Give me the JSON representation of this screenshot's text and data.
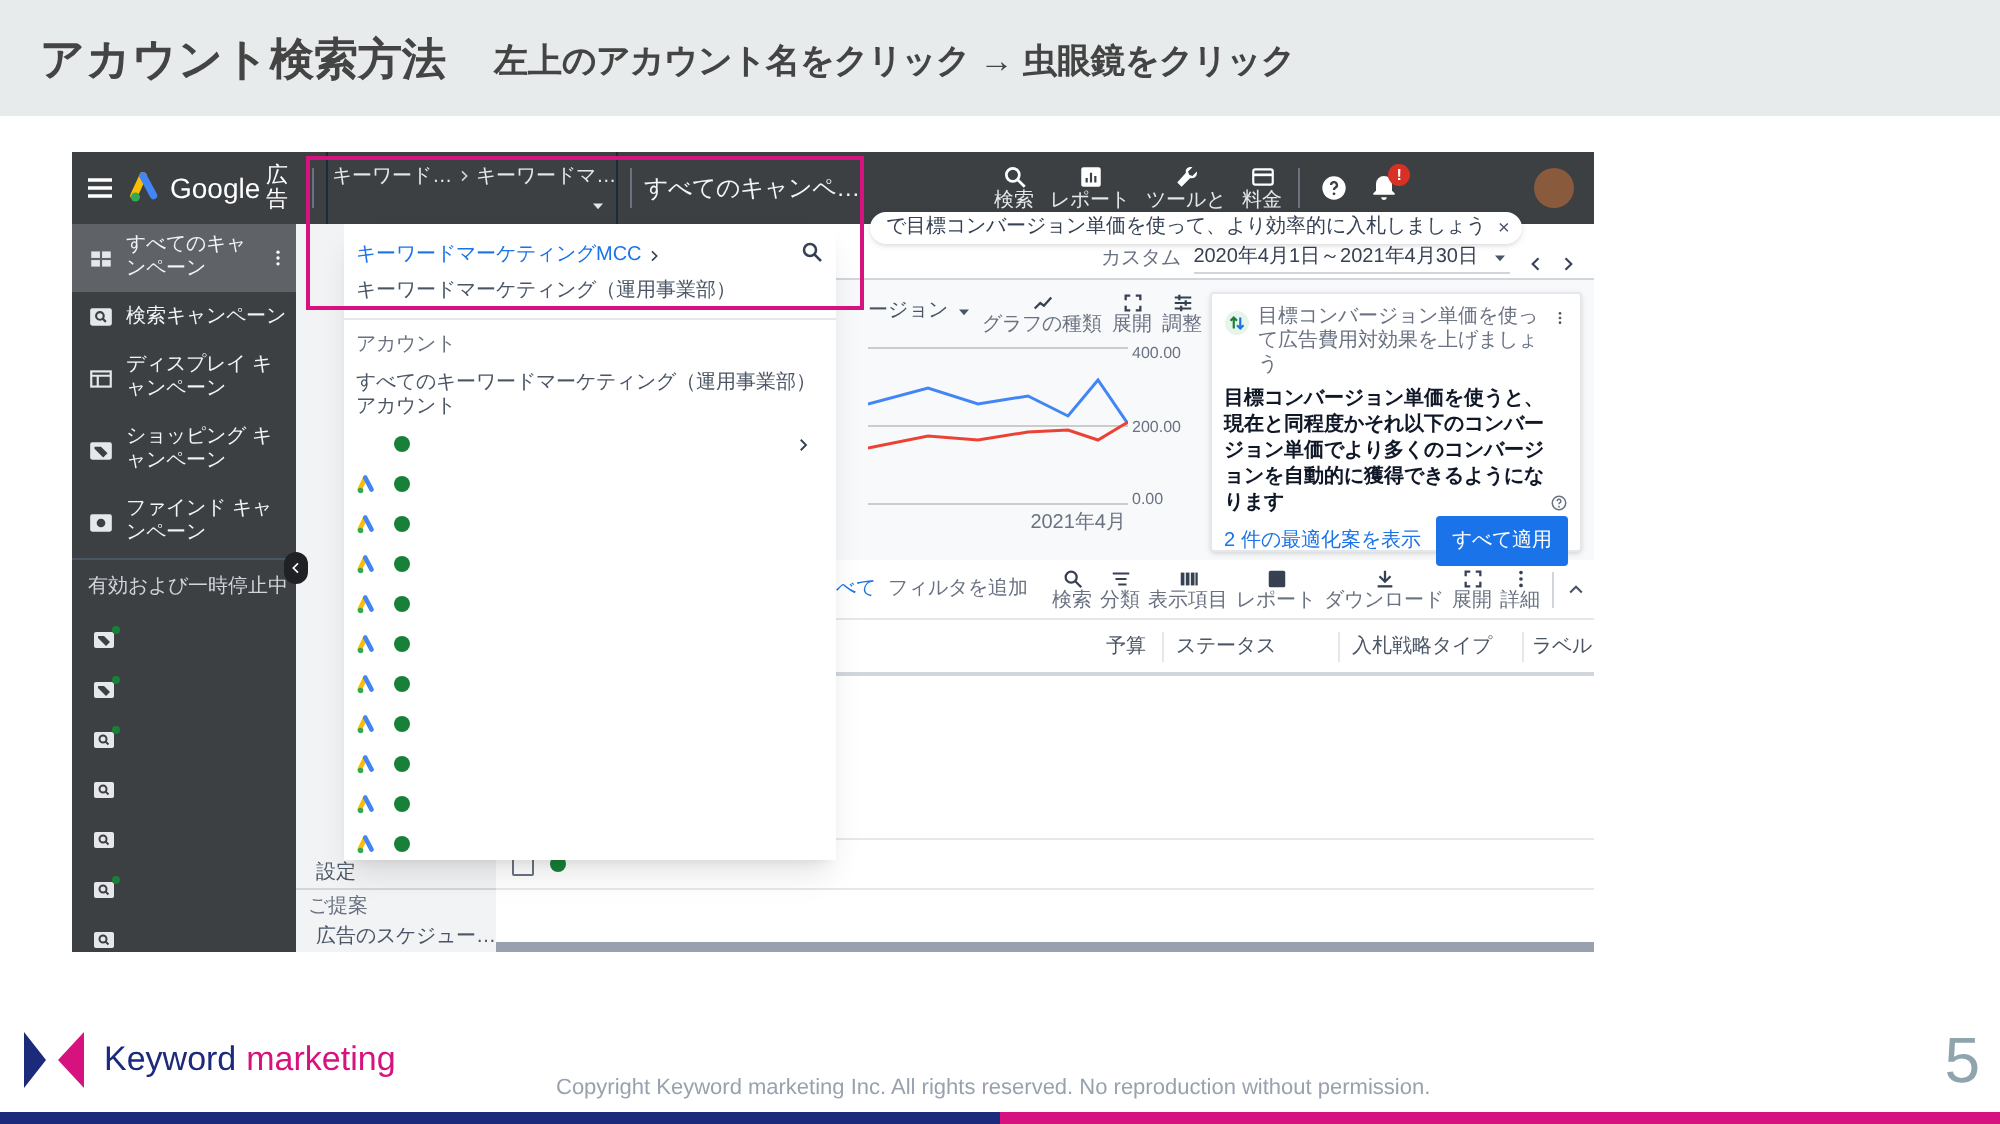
{
  "slide": {
    "title": "アカウント検索方法",
    "subtitle": "左上のアカウント名をクリック → 虫眼鏡をクリック",
    "brand_word1": "Keyword",
    "brand_word2": "marketing",
    "copyright": "Copyright Keyword marketing Inc. All rights reserved. No reproduction without permission.",
    "page_number": "5"
  },
  "app": {
    "header": {
      "product": "Google",
      "product_suffix": "広告",
      "account_path": [
        "キーワード…",
        "キーワードマ…"
      ],
      "scope": "すべてのキャンペ…",
      "tools": [
        {
          "kind": "search",
          "label": "検索"
        },
        {
          "kind": "report",
          "label": "レポート"
        },
        {
          "kind": "wrench",
          "label": "ツールと"
        },
        {
          "kind": "card",
          "label": "料金"
        }
      ],
      "notification_badge": "!"
    },
    "notice": {
      "text": "で目標コンバージョン単価を使って、より効率的に入札しましょう",
      "close": "×"
    },
    "sidebar": {
      "items": [
        {
          "kind": "grid",
          "label": "すべてのキャンペーン",
          "selected": true
        },
        {
          "kind": "search",
          "label": "検索キャンペーン",
          "selected": false
        },
        {
          "kind": "display",
          "label": "ディスプレイ キャンペーン",
          "selected": false
        },
        {
          "kind": "tag",
          "label": "ショッピング キャンペーン",
          "selected": false
        },
        {
          "kind": "find",
          "label": "ファインド キャンペーン",
          "selected": false
        }
      ],
      "filter_label": "有効および一時停止中",
      "campaigns": [
        {
          "kind": "tag",
          "active": true
        },
        {
          "kind": "tag",
          "active": true
        },
        {
          "kind": "search",
          "active": true
        },
        {
          "kind": "search",
          "active": false
        },
        {
          "kind": "search",
          "active": false
        },
        {
          "kind": "search",
          "active": true
        },
        {
          "kind": "search",
          "active": false
        }
      ]
    },
    "nav": [
      {
        "kind": "item",
        "label": "設定"
      },
      {
        "kind": "heading",
        "label": "ご提案"
      },
      {
        "kind": "item",
        "label": "広告のスケジュー…"
      }
    ],
    "date": {
      "label": "カスタム",
      "range": "2020年4月1日～2021年4月30日"
    },
    "chart": {
      "metric": "ージョン",
      "tools": [
        {
          "kind": "linechart",
          "label": "グラフの種類"
        },
        {
          "kind": "expand",
          "label": "展開"
        },
        {
          "kind": "tune",
          "label": "調整"
        }
      ],
      "y_labels": [
        "400.00",
        "200.00",
        "0.00"
      ],
      "x_label": "2021年4月"
    },
    "card": {
      "title": "目標コンバージョン単価を使って広告費用対効果を上げましょう",
      "body": "目標コンバージョン単価を使うと、現在と同程度かそれ以下のコンバージョン単価でより多くのコンバージョンを自動的に獲得できるようになります",
      "link": "2 件の最適化案を表示",
      "button": "すべて適用"
    },
    "table": {
      "filter_prefix": "べて",
      "filter": "フィルタを追加",
      "tools": [
        {
          "kind": "search",
          "label": "検索"
        },
        {
          "kind": "filterlines",
          "label": "分類"
        },
        {
          "kind": "columns",
          "label": "表示項目"
        },
        {
          "kind": "report",
          "label": "レポート"
        },
        {
          "kind": "download",
          "label": "ダウンロード"
        },
        {
          "kind": "expand",
          "label": "展開"
        },
        {
          "kind": "kebab",
          "label": "詳細"
        }
      ],
      "columns": [
        "予算",
        "ステータス",
        "入札戦略タイプ",
        "ラベル"
      ],
      "rows": [
        {
          "checked": false,
          "active": true
        }
      ]
    },
    "dropdown": {
      "parent": "キーワードマーケティングMCC",
      "current": "キーワードマーケティング（運用事業部）",
      "section": "アカウント",
      "all_accounts": "すべてのキーワードマーケティング（運用事業部）アカウント",
      "accounts": [
        {
          "kind": "manager",
          "active": true
        },
        {
          "kind": "account",
          "active": true
        },
        {
          "kind": "account",
          "active": true
        },
        {
          "kind": "account",
          "active": true
        },
        {
          "kind": "account",
          "active": true
        },
        {
          "kind": "account",
          "active": true
        },
        {
          "kind": "account",
          "active": true
        },
        {
          "kind": "account",
          "active": true
        },
        {
          "kind": "account",
          "active": true
        },
        {
          "kind": "account",
          "active": true
        },
        {
          "kind": "account",
          "active": true
        }
      ]
    }
  }
}
